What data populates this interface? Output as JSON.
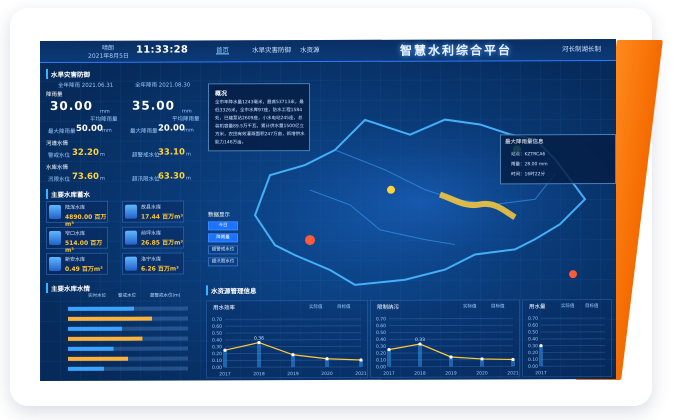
{
  "topbar": {
    "status_label": "晴朗",
    "date": "2021年8月5日",
    "time": "11:33:28",
    "nav": [
      "首页",
      "水旱灾害防御",
      "水资源"
    ],
    "nav_right": "河长制湖长制",
    "title": "智慧水利综合平台"
  },
  "left": {
    "section1_title": "水旱灾害防御",
    "date_a": "全年降雨 2021.06.31",
    "date_b": "全年降雨 2021.08.30",
    "rain_title": "降雨量",
    "rain_left": {
      "value": "30.00",
      "unit": "mm",
      "sub_label": "最大降雨量",
      "sub_value": "50.00",
      "sub_unit": "mm",
      "avg_label": "平均降雨量"
    },
    "rain_right": {
      "value": "35.00",
      "unit": "mm",
      "sub_label": "最大降雨量",
      "sub_value": "20.00",
      "sub_unit": "mm",
      "avg_label": "平均降雨量"
    },
    "river_title": "河道水情",
    "river_a": {
      "label": "警戒水位",
      "value": "32.20",
      "unit": "m"
    },
    "river_b": {
      "label": "超警戒水位",
      "value": "33.10",
      "unit": "m"
    },
    "reservoir_title": "水库水情",
    "reservoir_a": {
      "label": "汛限水位",
      "value": "73.60",
      "unit": "m"
    },
    "reservoir_b": {
      "label": "超汛限水位",
      "value": "63.30",
      "unit": "m"
    },
    "section2_title": "主要水库蓄水",
    "tiles": [
      {
        "name": "陆浑水库",
        "value": "4890.00 百万m³"
      },
      {
        "name": "故县水库",
        "value": "17.44 百万m³"
      },
      {
        "name": "窄口水库",
        "value": "514.00 百万m³"
      },
      {
        "name": "前坪水库",
        "value": "26.85 百万m³"
      },
      {
        "name": "新安水库",
        "value": "0.49 百万m³"
      },
      {
        "name": "洛宁水库",
        "value": "6.26 百万m³"
      }
    ],
    "section3_title": "主要水库水情",
    "bars_legend": [
      "实时水位",
      "警戒水位",
      "超警戒水位(m)"
    ],
    "bars": [
      0.55,
      0.7,
      0.45,
      0.62,
      0.38,
      0.5,
      0.3
    ]
  },
  "map": {
    "popup_title": "概况",
    "popup_text": "全市年降水量1243毫米，最高53713米，最低3326米，全市水库97座，防水工程1584处，已建泵站2609座，小水电站245座，总装机容量89.5万千瓦，累计供水量1500亿立方米，农田有效灌溉面积247万亩，新增供水能力146万亩。",
    "legend_title": "数据显示",
    "legend_items": [
      "今日",
      "降雨量",
      "超警戒水位",
      "超汛限水位"
    ],
    "alert_title": "最大降雨量信息",
    "alert_lines": [
      "站点：KZTRCA6",
      "雨量：28.00 mm",
      "时间：16时22分"
    ]
  },
  "bottom": {
    "left_title": "主要水库水情",
    "mid_title": "水资源管理信息",
    "charts": [
      {
        "label": "用水效率",
        "legend": [
          "实际值",
          "目标值"
        ],
        "ylim": [
          0,
          0.7
        ],
        "x": [
          "2017",
          "2018",
          "2019",
          "2020",
          "2021"
        ],
        "values": [
          0.25,
          0.36,
          0.18,
          0.12,
          0.1
        ],
        "value_label": "0.36"
      },
      {
        "label": "限制纳污",
        "legend": [
          "实际值",
          "目标值"
        ],
        "ylim": [
          0,
          0.7
        ],
        "x": [
          "2017",
          "2018",
          "2019",
          "2020",
          "2021"
        ],
        "values": [
          0.25,
          0.33,
          0.14,
          0.11,
          0.1
        ],
        "value_label": "0.33"
      },
      {
        "label": "用水量",
        "legend": [
          "实际值",
          "目标值"
        ],
        "ylim": [
          0,
          0.7
        ],
        "x": [
          "2017"
        ],
        "values": [
          0.3
        ],
        "value_label": ""
      }
    ]
  },
  "colors": {
    "accent": "#2f7cff",
    "orange": "#f46a00",
    "yellow": "#ffc83a"
  }
}
